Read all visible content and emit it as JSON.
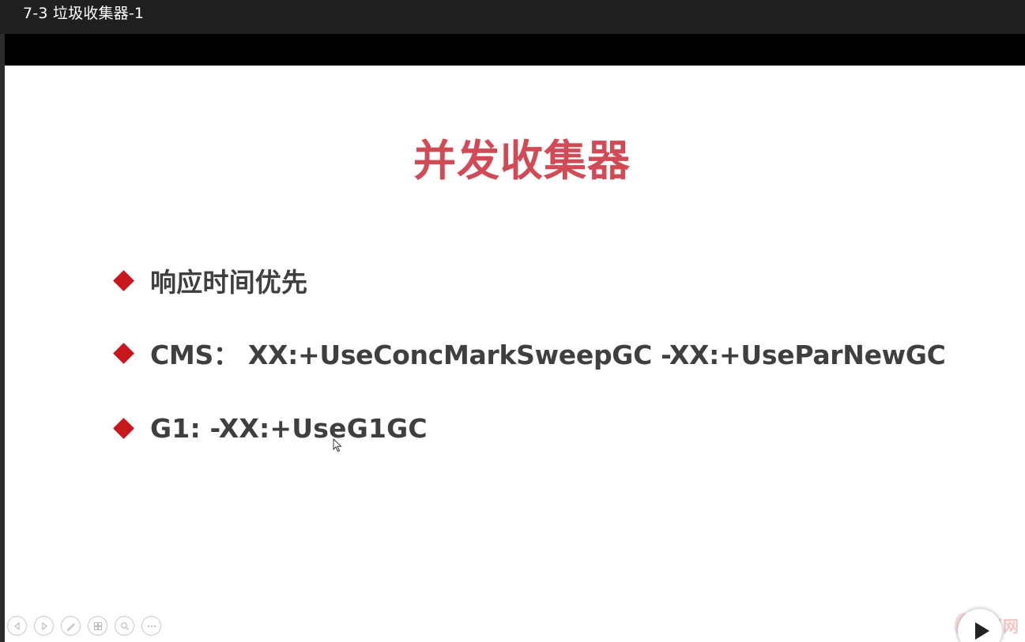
{
  "window": {
    "title": "7-3 垃圾收集器-1"
  },
  "slide": {
    "title": "并发收集器",
    "bullets": [
      "响应时间优先",
      "CMS： XX:+UseConcMarkSweepGC -XX:+UseParNewGC",
      "G1: -XX:+UseG1GC"
    ]
  },
  "controls": {
    "icons": [
      "previous-icon",
      "next-icon",
      "pen-icon",
      "slides-grid-icon",
      "zoom-icon",
      "more-icon"
    ]
  },
  "watermark": {
    "text": "课网"
  },
  "colors": {
    "title": "#d14b56",
    "bullet_marker": "#c8161d",
    "bullet_text": "#3f3f3f",
    "titlebar_bg": "#202020"
  }
}
